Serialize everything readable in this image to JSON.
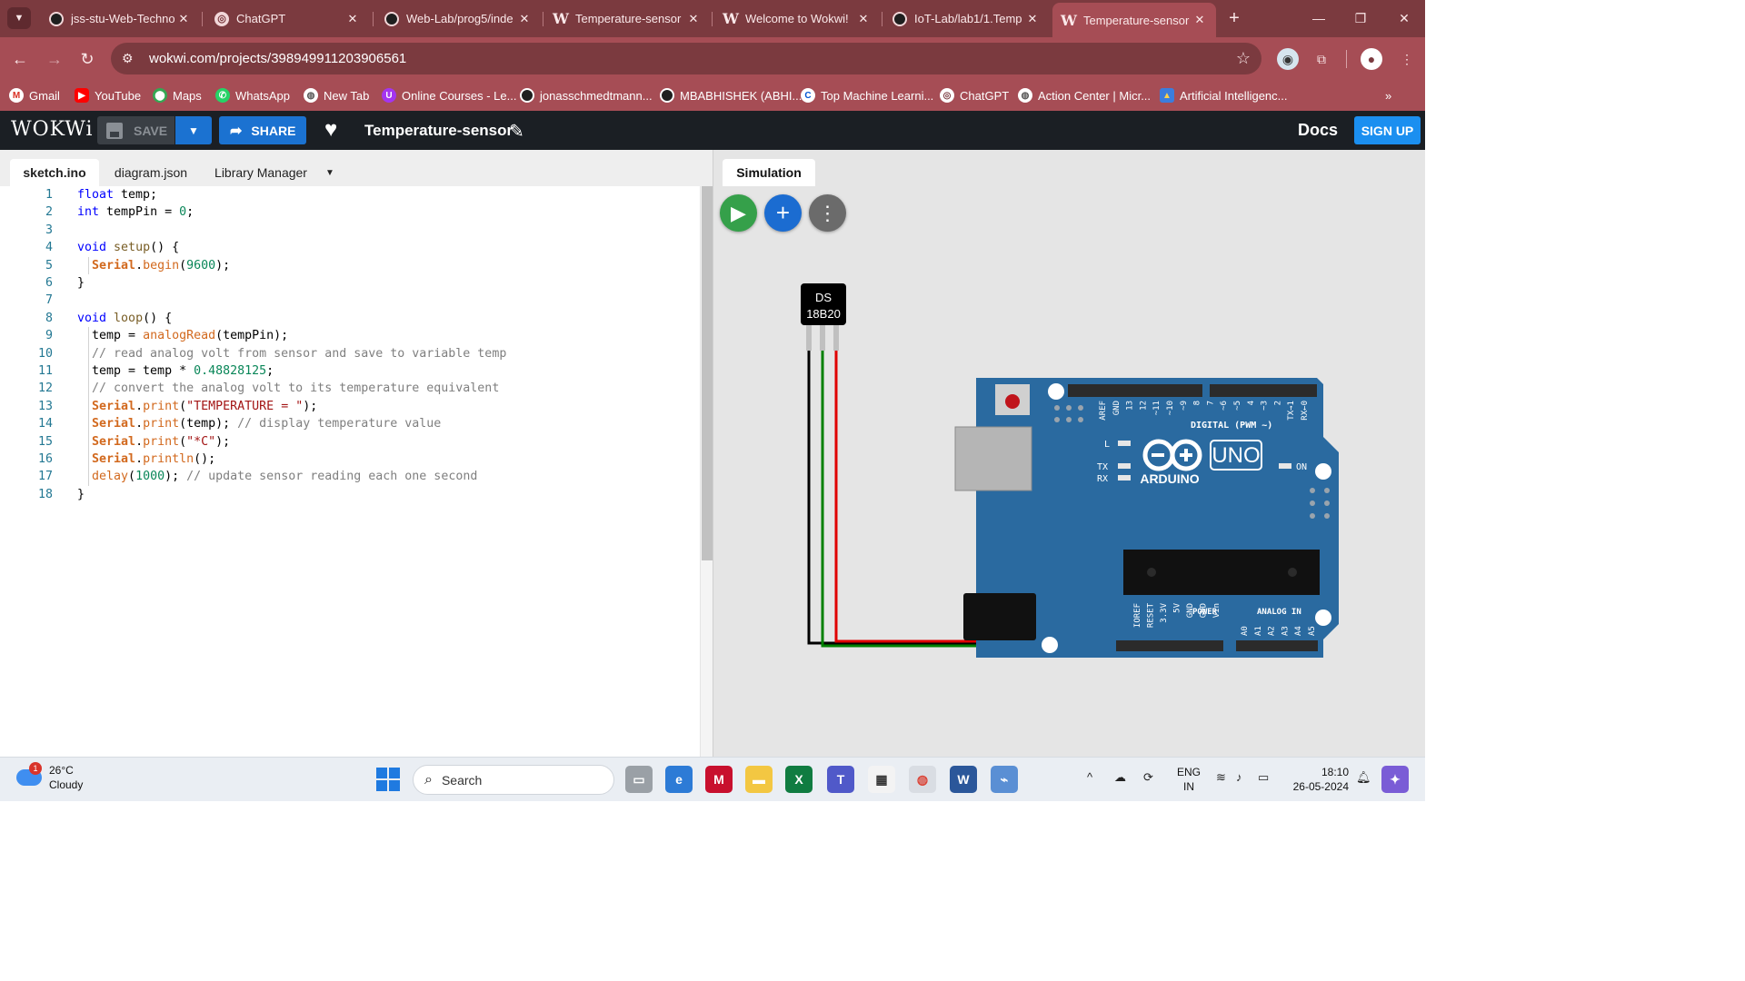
{
  "browser": {
    "tabs": [
      {
        "title": "jss-stu-Web-Technolo",
        "favicon": "github-icon"
      },
      {
        "title": "ChatGPT",
        "favicon": "chatgpt-icon"
      },
      {
        "title": "Web-Lab/prog5/inde",
        "favicon": "github-icon"
      },
      {
        "title": "Temperature-sensor",
        "favicon": "wokwi-icon"
      },
      {
        "title": "Welcome to Wokwi!",
        "favicon": "wokwi-icon"
      },
      {
        "title": "IoT-Lab/lab1/1.Temp",
        "favicon": "github-icon"
      },
      {
        "title": "Temperature-sensor",
        "favicon": "wokwi-icon",
        "active": true
      }
    ],
    "close_glyph": "✕",
    "new_tab_glyph": "+",
    "url": "wokwi.com/projects/398949911203906561",
    "bookmarks": [
      {
        "label": "Gmail",
        "icon": "gmail-icon"
      },
      {
        "label": "YouTube",
        "icon": "youtube-icon"
      },
      {
        "label": "Maps",
        "icon": "maps-icon"
      },
      {
        "label": "WhatsApp",
        "icon": "whatsapp-icon"
      },
      {
        "label": "New Tab",
        "icon": "chrome-icon"
      },
      {
        "label": "Online Courses - Le...",
        "icon": "udemy-icon"
      },
      {
        "label": "jonasschmedtmann...",
        "icon": "github-icon"
      },
      {
        "label": "MBABHISHEK (ABHI...",
        "icon": "github-icon"
      },
      {
        "label": "Top Machine Learni...",
        "icon": "coursera-icon"
      },
      {
        "label": "ChatGPT",
        "icon": "chatgpt-icon"
      },
      {
        "label": "Action Center | Micr...",
        "icon": "chrome-icon"
      },
      {
        "label": "Artificial Intelligenc...",
        "icon": "ai-icon"
      }
    ]
  },
  "wokwi": {
    "logo": "WOKWi",
    "save_label": "SAVE",
    "share_label": "SHARE",
    "project_title": "Temperature-sensor",
    "docs_label": "Docs",
    "signup_label": "SIGN UP",
    "editor_tabs": [
      "sketch.ino",
      "diagram.json",
      "Library Manager"
    ],
    "simulation_tab": "Simulation",
    "code_lines": [
      "float temp;",
      "int tempPin = 0;",
      "",
      "void setup() {",
      "  Serial.begin(9600);",
      "}",
      "",
      "void loop() {",
      "  temp = analogRead(tempPin);",
      "  // read analog volt from sensor and save to variable temp",
      "  temp = temp * 0.48828125;",
      "  // convert the analog volt to its temperature equivalent",
      "  Serial.print(\"TEMPERATURE = \");",
      "  Serial.print(temp); // display temperature value",
      "  Serial.print(\"*C\");",
      "  Serial.println();",
      "  delay(1000); // update sensor reading each one second",
      "}"
    ],
    "sensor_label_line1": "DS",
    "sensor_label_line2": "18B20",
    "board": {
      "brand": "ARDUINO",
      "model": "UNO",
      "digital_label": "DIGITAL (PWM ~)",
      "power_label": "POWER",
      "analog_label": "ANALOG IN",
      "on_label": "ON",
      "tx_label": "TX",
      "rx_label": "RX",
      "l_label": "L",
      "top_pins": [
        "AREF",
        "GND",
        "13",
        "12",
        "~11",
        "~10",
        "~9",
        "8",
        "7",
        "~6",
        "~5",
        "4",
        "~3",
        "2",
        "TX→1",
        "RX←0"
      ],
      "power_pins": [
        "IOREF",
        "RESET",
        "3.3V",
        "5V",
        "GND",
        "GND",
        "Vin"
      ],
      "analog_pins": [
        "A0",
        "A1",
        "A2",
        "A3",
        "A4",
        "A5"
      ]
    },
    "colors": {
      "wire_ground": "#000000",
      "wire_data": "#008000",
      "wire_power": "#e00000",
      "board": "#2a6aa0",
      "run": "#35a04a",
      "add": "#1b6cd1",
      "more": "#6b6b6b"
    }
  },
  "taskbar": {
    "weather_temp": "26°C",
    "weather_desc": "Cloudy",
    "weather_badge": "1",
    "search_label": "Search",
    "lang_line1": "ENG",
    "lang_line2": "IN",
    "time": "18:10",
    "date": "26-05-2024"
  }
}
